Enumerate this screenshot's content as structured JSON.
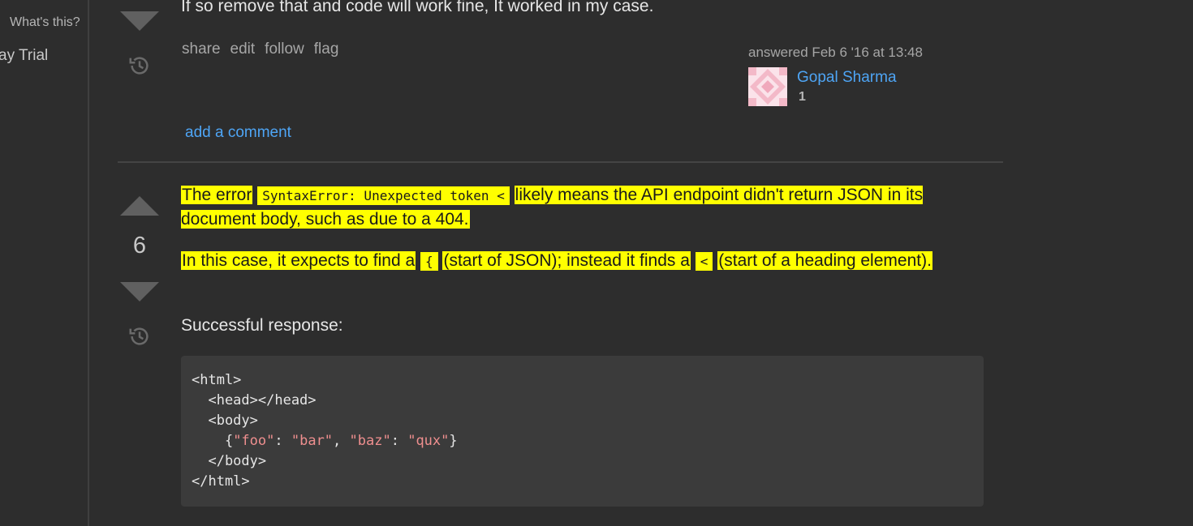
{
  "sidebar": {
    "whats_this": "What's this?",
    "trial": "ay Trial"
  },
  "answer1": {
    "body_tail": "If so remove that and code will work fine, It worked in my case.",
    "menu": {
      "share": "share",
      "edit": "edit",
      "follow": "follow",
      "flag": "flag"
    },
    "user": {
      "action_time": "answered Feb 6 '16 at 13:48",
      "name": "Gopal Sharma",
      "reputation": "1"
    },
    "add_comment": "add a comment"
  },
  "answer2": {
    "vote_count": "6",
    "p1": {
      "t1": "The error",
      "code": "SyntaxError: Unexpected token <",
      "t2": "likely means the API endpoint didn't return JSON in its document body, such as due to a 404."
    },
    "p2": {
      "t1": "In this case, it expects to find a",
      "code1": "{",
      "t2": "(start of JSON); instead it finds a",
      "code2": "<",
      "t3": "(start of a heading element)."
    },
    "p3": "Successful response:",
    "code_lines": {
      "l1": "<html>",
      "l2": "  <head></head>",
      "l3": "  <body>",
      "l4_open": "    {",
      "l4_s1": "\"foo\"",
      "l4_c1": ": ",
      "l4_s2": "\"bar\"",
      "l4_c2": ", ",
      "l4_s3": "\"baz\"",
      "l4_c3": ": ",
      "l4_s4": "\"qux\"",
      "l4_close": "}",
      "l5": "  </body>",
      "l6": "</html>"
    }
  },
  "colors": {
    "background": "#2d2d2d",
    "link": "#4ea5f5",
    "highlight": "#ffff00",
    "code_bg": "#3b3b3b",
    "string": "#ef8f8f"
  },
  "icons": [
    "downvote-arrow-icon",
    "upvote-arrow-icon",
    "history-icon",
    "gravatar-icon"
  ]
}
